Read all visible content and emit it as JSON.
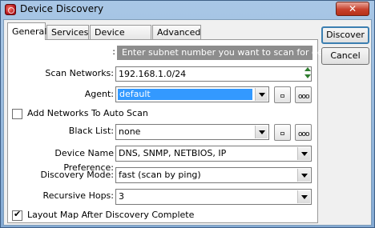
{
  "window": {
    "title": "Device Discovery",
    "close_glyph": "✕"
  },
  "tabs": [
    {
      "label": "General",
      "active": true
    },
    {
      "label": "Services"
    },
    {
      "label": "Device Types"
    },
    {
      "label": "Advanced"
    }
  ],
  "form": {
    "hint_prefix": ":",
    "hint": "Enter subnet number you want to scan for devices",
    "scan_networks_label": "Scan Networks:",
    "scan_networks_value": "192.168.1.0/24",
    "agent_label": "Agent:",
    "agent_value": "default",
    "add_networks_label": "Add Networks To Auto Scan",
    "add_networks_checked": false,
    "black_list_label": "Black List:",
    "black_list_value": "none",
    "name_pref_label": "Device Name Preference:",
    "name_pref_value": "DNS, SNMP, NETBIOS, IP",
    "discovery_mode_label": "Discovery Mode:",
    "discovery_mode_value": "fast (scan by ping)",
    "recursive_hops_label": "Recursive Hops:",
    "recursive_hops_value": "3",
    "layout_map_label": "Layout Map After Discovery Complete",
    "layout_map_checked": true,
    "small_btn_single": "▫",
    "small_btn_dots": "ooo"
  },
  "buttons": {
    "discover": "Discover",
    "cancel": "Cancel"
  }
}
